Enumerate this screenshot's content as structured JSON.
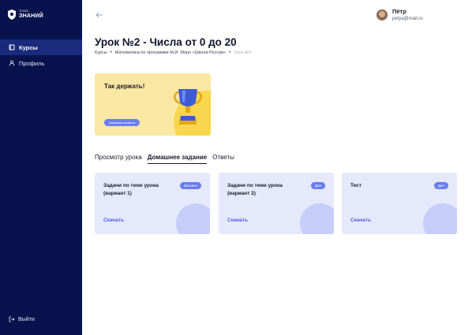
{
  "brand": {
    "line1": "ТОЧКА",
    "line2": "ЗНАНИЙ"
  },
  "sidebar": {
    "items": [
      {
        "label": "Курсы",
        "icon": "book-icon",
        "active": true
      },
      {
        "label": "Профиль",
        "icon": "user-icon",
        "active": false
      }
    ],
    "logout_label": "Выйти"
  },
  "user": {
    "name": "Пётр",
    "email": "petya@mail.ru"
  },
  "page": {
    "title": "Урок №2 - Числа от 0 до 20",
    "breadcrumb": [
      "Курсы",
      "Математика по программе М.И. Моро «Школа России»",
      "Урок №2"
    ]
  },
  "banner": {
    "title": "Так держать!",
    "button_label": "Домашка принята"
  },
  "tabs": [
    {
      "label": "Просмотр урока",
      "active": false
    },
    {
      "label": "Домашнее задание",
      "active": true
    },
    {
      "label": "Ответы",
      "active": false
    }
  ],
  "cards": [
    {
      "title": "Задачи по теме урока (вариант 1)",
      "badge": "Базовое",
      "link": "Скачать"
    },
    {
      "title": "Задачи по теме урока (вариант 2)",
      "badge": "Доп",
      "link": "Скачать"
    },
    {
      "title": "Тест",
      "badge": "Доп",
      "link": "Скачать"
    }
  ],
  "colors": {
    "sidebar_bg": "#08134d",
    "sidebar_active": "#1a2a7c",
    "accent": "#6b7cf0",
    "link": "#4a5cea",
    "banner_bg": "#fbe7a4",
    "card_bg": "#e5e9fb"
  }
}
